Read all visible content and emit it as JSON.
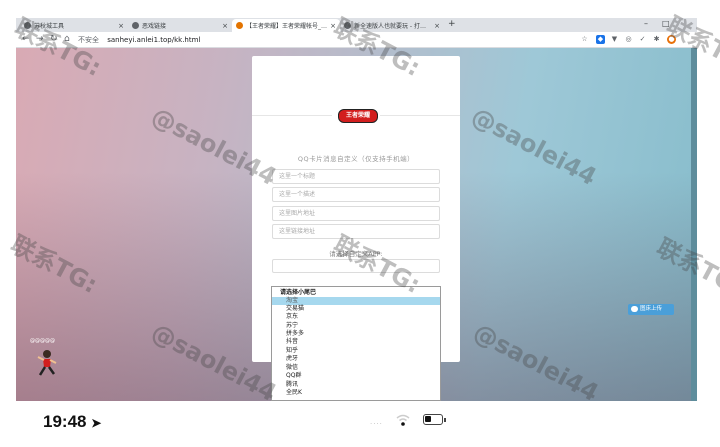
{
  "browser": {
    "tabs": [
      {
        "label": "苏秋城工具",
        "active": false
      },
      {
        "label": "恶戏链接",
        "active": false
      },
      {
        "label": "【王者荣耀】王者荣耀帐号_0[Q",
        "active": true
      },
      {
        "label": "新全速版人也就要玩 - 打造圈内",
        "active": false
      }
    ],
    "new_tab": "+",
    "window_min": "–",
    "window_max": "□",
    "address": {
      "security": "不安全",
      "url": "sanheyi.anlei1.top/kk.html"
    }
  },
  "card": {
    "logo_text": "王者荣耀",
    "subtitle": "QQ卡片消息自定义（仅支持手机端）",
    "fields": [
      {
        "placeholder": "这里一个标题"
      },
      {
        "placeholder": "这里一个描述"
      },
      {
        "placeholder": "这里图片地址"
      },
      {
        "placeholder": "这里链接地址"
      }
    ],
    "select_label": "请选择自定义APP:"
  },
  "dropdown": {
    "header": "请选择小尾巴",
    "options": [
      "淘宝",
      "交易猫",
      "京东",
      "苏宁",
      "拼多多",
      "抖音",
      "知乎",
      "虎牙",
      "微信",
      "QQ群",
      "腾讯",
      "全民K"
    ],
    "selected_index": 0
  },
  "upload_button": "图床上传",
  "mascot_label": "@@@@@",
  "status_bar": {
    "time": "19:48",
    "dots": "····"
  },
  "watermarks": {
    "line1": "联系TG:",
    "line2": "@saolei44"
  },
  "colors": {
    "logo_red": "#d21e1e",
    "dropdown_selected": "#a6d8ee",
    "upload_blue": "#4a9fd9"
  }
}
